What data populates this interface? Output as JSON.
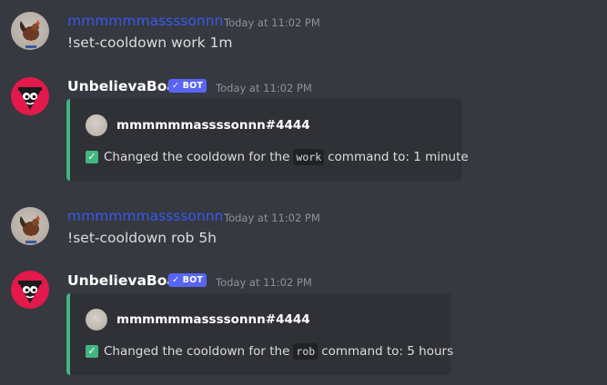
{
  "messages": [
    {
      "author": "mmmmmmassssonnn",
      "timestamp": "Today at 11:02 PM",
      "text": "!set-cooldown work 1m"
    },
    {
      "author": "UnbelievaBoat",
      "bot_tag": "✓ BOT",
      "timestamp": "Today at 11:02 PM",
      "embed": {
        "author": "mmmmmmassssonnn#4444",
        "desc_prefix": "Changed the cooldown for the",
        "command": "work",
        "desc_suffix": "command to: 1 minute",
        "accent": "#43b581"
      }
    },
    {
      "author": "mmmmmmassssonnn",
      "timestamp": "Today at 11:02 PM",
      "text": "!set-cooldown rob 5h"
    },
    {
      "author": "UnbelievaBoat",
      "bot_tag": "✓ BOT",
      "timestamp": "Today at 11:02 PM",
      "embed": {
        "author": "mmmmmmassssonnn#4444",
        "desc_prefix": "Changed the cooldown for the",
        "command": "rob",
        "desc_suffix": "command to: 5 hours",
        "accent": "#43b581"
      }
    }
  ],
  "colors": {
    "background": "#36393f",
    "user_name": "#3858f0",
    "bot_badge": "#5865f2",
    "embed_bg": "#2f3136",
    "embed_accent": "#43b581"
  },
  "icons": {
    "user_avatar": "rooster-avatar",
    "bot_avatar": "unbelievaboat-avatar",
    "check": "check-box-icon"
  }
}
